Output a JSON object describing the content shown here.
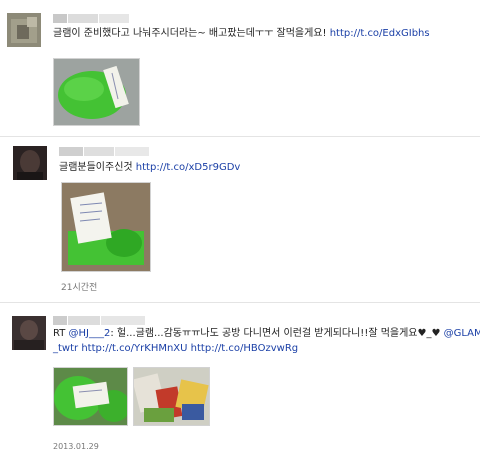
{
  "posts": [
    {
      "text": "글램이 준비했다고 나눠주시더라는~ 배고팠는데ㅜㅜ 잘먹을게요!",
      "link": "http://t.co/EdxGIbhs"
    },
    {
      "text": "글램분들이주신것",
      "link": "http://t.co/xD5r9GDv",
      "time": "21시간전"
    },
    {
      "rt_prefix": "RT",
      "mention1": "@HJ___2",
      "text": ": 헐...글램...감동ㅠㅠ나도 공방 다니면서 이런걸 받게되다니!!잘 먹을게요♥_♥",
      "mention2": "@GLAM",
      "mention2_cont": "_twtr",
      "link1": "http://t.co/YrKHMnXU",
      "link2": "http://t.co/HBOzvwRg",
      "time": "2013.01.29"
    }
  ],
  "colors": {
    "link": "#1a3fa6",
    "divider": "#e4e4e4",
    "green": "#44c234"
  }
}
